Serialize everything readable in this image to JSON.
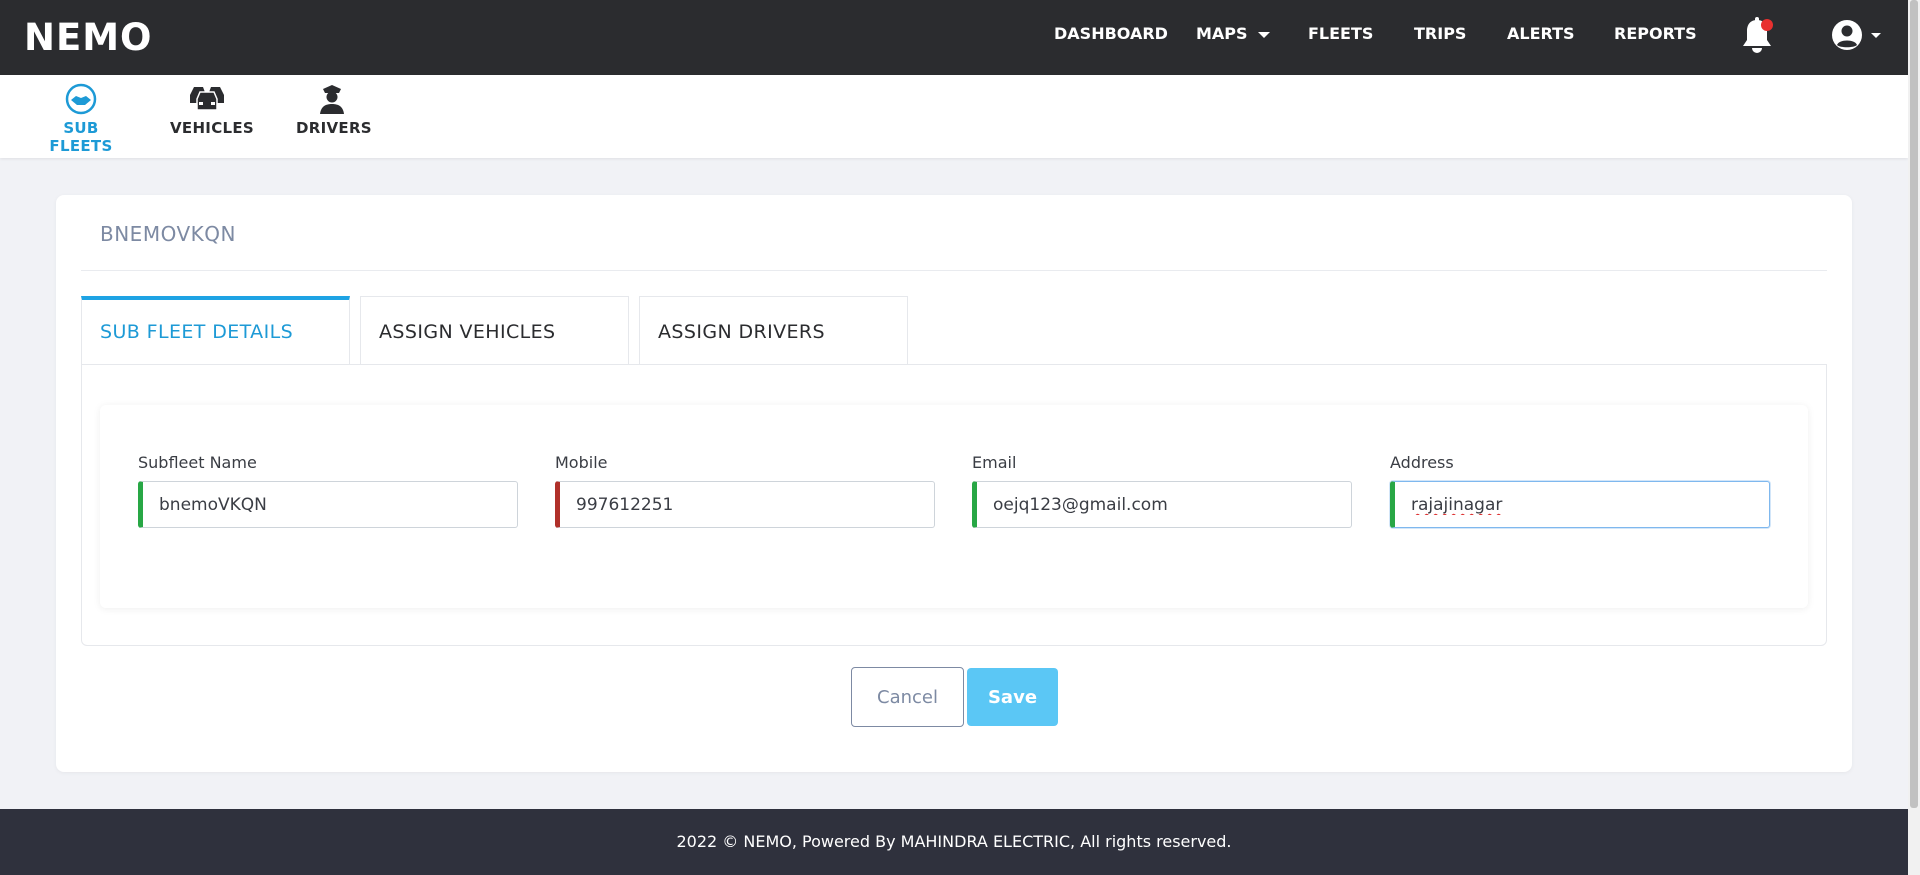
{
  "app": {
    "logo": "NEMO"
  },
  "nav": {
    "items": [
      {
        "label": "DASHBOARD"
      },
      {
        "label": "MAPS"
      },
      {
        "label": "FLEETS"
      },
      {
        "label": "TRIPS"
      },
      {
        "label": "ALERTS"
      },
      {
        "label": "REPORTS"
      }
    ],
    "notification_icon": "bell-icon",
    "user_icon": "user-circle-icon"
  },
  "subnav": {
    "items": [
      {
        "label": "SUB FLEETS",
        "icon": "handshake-icon",
        "active": true
      },
      {
        "label": "VEHICLES",
        "icon": "cars-icon",
        "active": false
      },
      {
        "label": "DRIVERS",
        "icon": "driver-icon",
        "active": false
      }
    ]
  },
  "card": {
    "title": "BNEMOVKQN",
    "tabs": [
      {
        "label": "SUB FLEET DETAILS",
        "active": true
      },
      {
        "label": "ASSIGN VEHICLES",
        "active": false
      },
      {
        "label": "ASSIGN DRIVERS",
        "active": false
      }
    ],
    "fields": [
      {
        "label": "Subfleet Name",
        "value": "bnemoVKQN",
        "status": "valid"
      },
      {
        "label": "Mobile",
        "value": "997612251",
        "status": "invalid"
      },
      {
        "label": "Email",
        "value": "oejq123@gmail.com",
        "status": "valid"
      },
      {
        "label": "Address",
        "value": "rajajinagar",
        "status": "valid"
      }
    ],
    "cancel_label": "Cancel",
    "save_label": "Save"
  },
  "footer": {
    "text": "2022 © NEMO, Powered By MAHINDRA ELECTRIC, All rights reserved."
  },
  "colors": {
    "navbar": "#2b2c2f",
    "accent": "#1d9ad6",
    "valid": "#28a745",
    "invalid": "#b0302a",
    "save": "#5bc7f5",
    "notification_dot": "#e8302f"
  }
}
